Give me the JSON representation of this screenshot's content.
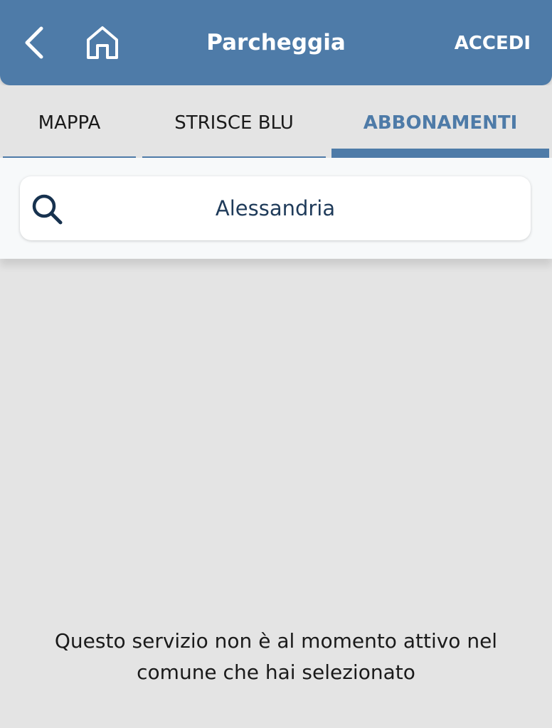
{
  "header": {
    "title": "Parcheggia",
    "login_label": "ACCEDI",
    "back_icon": "chevron-left-icon",
    "home_icon": "home-icon",
    "background_color": "#4e7ba8"
  },
  "tabs": [
    {
      "label": "MAPPA",
      "active": false
    },
    {
      "label": "STRISCE BLU",
      "active": false
    },
    {
      "label": "ABBONAMENTI",
      "active": true
    }
  ],
  "search": {
    "value": "Alessandria",
    "icon": "search-icon"
  },
  "message": {
    "line1": "Questo servizio non è al momento attivo nel",
    "line2": "comune che hai selezionato"
  },
  "colors": {
    "accent": "#4e7ba8",
    "background": "#e4e4e4",
    "search_text": "#1f3b5a"
  }
}
